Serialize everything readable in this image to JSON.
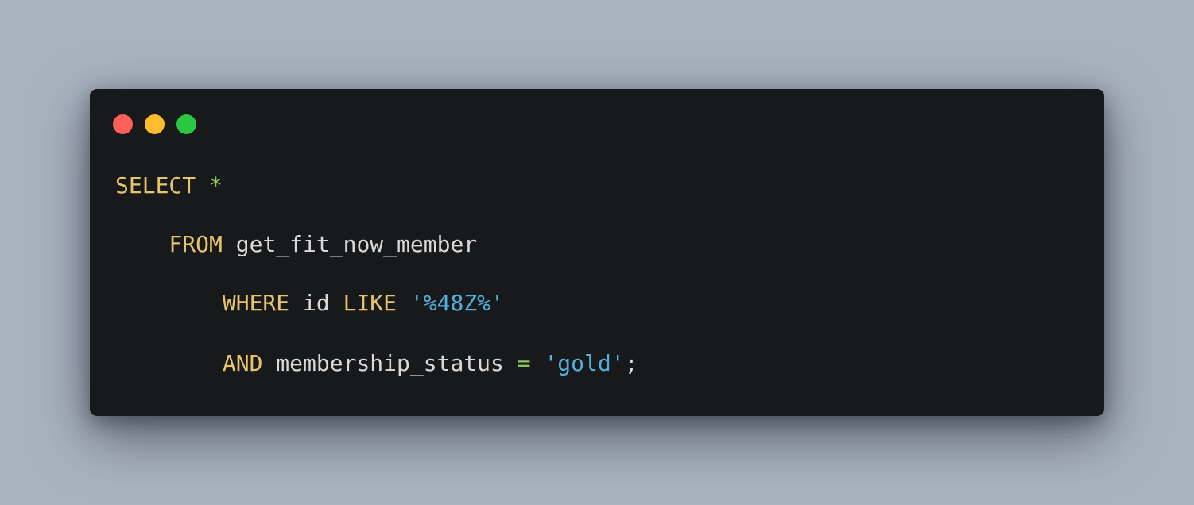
{
  "colors": {
    "background": "#a9b3c0",
    "window": "#18191b",
    "keyword": "#e5c46d",
    "identifier": "#d9d9d9",
    "operator": "#8fc65c",
    "string": "#4fb1dc",
    "punctuation": "#d9d9d9",
    "dot_close": "#fe5f57",
    "dot_minimize": "#febc2e",
    "dot_maximize": "#28c840"
  },
  "window_controls": [
    {
      "name": "close",
      "icon": "red-dot-icon"
    },
    {
      "name": "minimize",
      "icon": "yellow-dot-icon"
    },
    {
      "name": "maximize",
      "icon": "green-dot-icon"
    }
  ],
  "code": {
    "lines": [
      [
        {
          "text": "SELECT",
          "type": "keyword"
        },
        {
          "text": " ",
          "type": "space"
        },
        {
          "text": "*",
          "type": "operator"
        }
      ],
      [
        {
          "text": "    ",
          "type": "space"
        },
        {
          "text": "FROM",
          "type": "keyword"
        },
        {
          "text": " ",
          "type": "space"
        },
        {
          "text": "get_fit_now_member",
          "type": "identifier"
        }
      ],
      [
        {
          "text": "        ",
          "type": "space"
        },
        {
          "text": "WHERE",
          "type": "keyword"
        },
        {
          "text": " ",
          "type": "space"
        },
        {
          "text": "id",
          "type": "identifier"
        },
        {
          "text": " ",
          "type": "space"
        },
        {
          "text": "LIKE",
          "type": "keyword"
        },
        {
          "text": " ",
          "type": "space"
        },
        {
          "text": "'%48Z%'",
          "type": "string"
        }
      ],
      [
        {
          "text": "        ",
          "type": "space"
        },
        {
          "text": "AND",
          "type": "keyword"
        },
        {
          "text": " ",
          "type": "space"
        },
        {
          "text": "membership_status",
          "type": "identifier"
        },
        {
          "text": " ",
          "type": "space"
        },
        {
          "text": "=",
          "type": "operator"
        },
        {
          "text": " ",
          "type": "space"
        },
        {
          "text": "'gold'",
          "type": "string"
        },
        {
          "text": ";",
          "type": "punctuation"
        }
      ]
    ]
  }
}
